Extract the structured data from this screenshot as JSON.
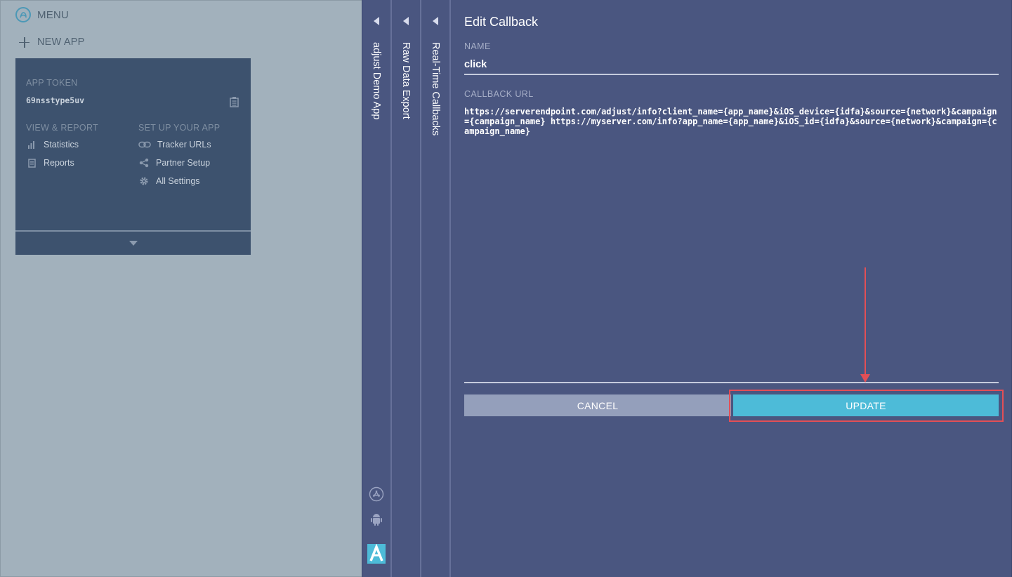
{
  "menu": {
    "label": "MENU",
    "icon": "adjust-logo-icon"
  },
  "new_app": {
    "label": "NEW APP",
    "icon": "plus-icon"
  },
  "app_card": {
    "token_label": "APP TOKEN",
    "token_value": "69nsstype5uv",
    "view_report": {
      "heading": "VIEW & REPORT",
      "items": [
        {
          "label": "Statistics",
          "icon": "bar-chart-icon"
        },
        {
          "label": "Reports",
          "icon": "report-icon"
        }
      ]
    },
    "setup": {
      "heading": "SET UP YOUR APP",
      "items": [
        {
          "label": "Tracker URLs",
          "icon": "link-icon"
        },
        {
          "label": "Partner Setup",
          "icon": "share-icon"
        },
        {
          "label": "All Settings",
          "icon": "gear-icon"
        }
      ]
    }
  },
  "panels": [
    {
      "title": "adjust Demo App"
    },
    {
      "title": "Raw Data Export"
    },
    {
      "title": "Real-Time Callbacks"
    }
  ],
  "edit_callback": {
    "title": "Edit Callback",
    "name_label": "NAME",
    "name_value": "click",
    "url_label": "CALLBACK URL",
    "url_value": "https://serverendpoint.com/adjust/info?client_name={app_name}&iOS_device={idfa}&source={network}&campaign={campaign_name} https://myserver.com/info?app_name={app_name}&iOS_id={idfa}&source={network}&campaign={campaign_name}",
    "cancel_label": "CANCEL",
    "update_label": "UPDATE"
  },
  "colors": {
    "background": "#a2b1bc",
    "panel": "#4a5680",
    "card": "#3d526e",
    "accent": "#4dbbd8",
    "highlight": "#e34f56"
  }
}
